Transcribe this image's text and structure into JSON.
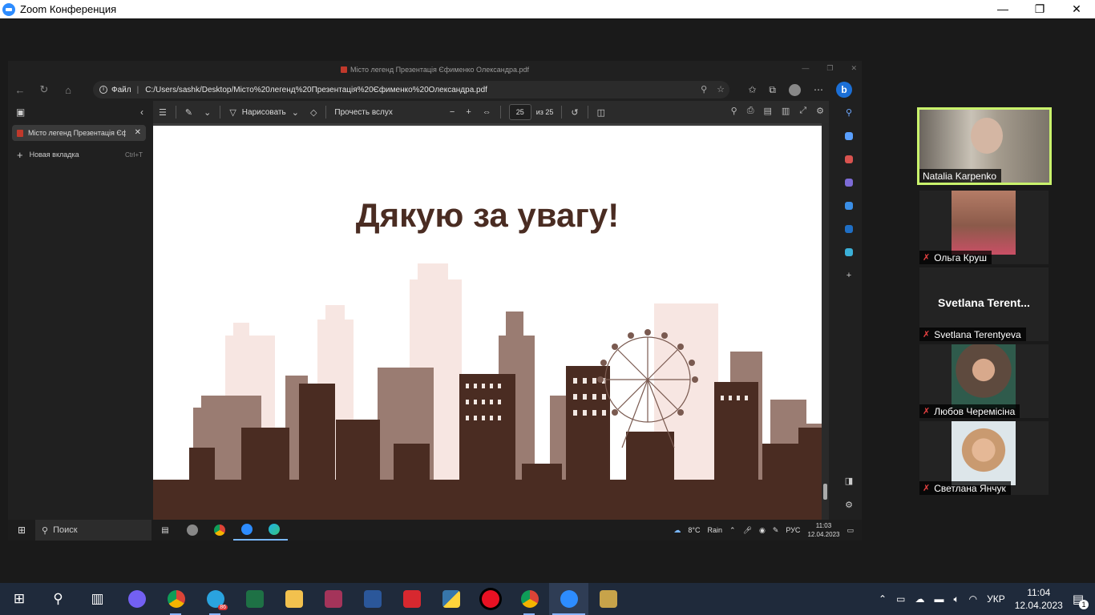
{
  "zoom_window": {
    "title": "Zoom Конференция",
    "minimize": "—",
    "restore": "❐",
    "close": "✕"
  },
  "edge": {
    "window_title": "Місто легенд Презентація Єфименко Олександра.pdf",
    "address": {
      "file_label": "Файл",
      "separator": "|",
      "url": "C:/Users/sashk/Desktop/Місто%20легенд%20Презентація%20Єфименко%20Олександра.pdf"
    },
    "tabs": [
      {
        "label": "Місто легенд Презентація Єфименко Олександра.pdf"
      }
    ],
    "new_tab": {
      "label": "Новая вкладка",
      "shortcut": "Ctrl+T"
    },
    "pdf_toolbar": {
      "draw_label": "Нарисовать",
      "read_aloud_label": "Прочесть вслух",
      "current_page": "25",
      "total_pages": "из 25"
    }
  },
  "slide": {
    "title": "Дякую за увагу!"
  },
  "inner_taskbar": {
    "search_label": "Поиск",
    "weather_temp": "8°C",
    "weather_text": "Rain",
    "language": "РУС",
    "time": "11:03",
    "date": "12.04.2023"
  },
  "participants": [
    {
      "name": "Natalia Karpenko",
      "active": true,
      "muted": false,
      "photo_color": "#a59c8e"
    },
    {
      "name": "Ольга Круш",
      "active": false,
      "muted": true,
      "photo_color": "#8b5a4a"
    },
    {
      "name": "Svetlana Terentyeva",
      "display_name": "Svetlana  Terent...",
      "active": false,
      "muted": true
    },
    {
      "name": "Любов Черемісіна",
      "active": false,
      "muted": true,
      "photo_color": "#5e4a3e"
    },
    {
      "name": "Светлана Янчук",
      "active": false,
      "muted": true,
      "photo_color": "#c99a70"
    }
  ],
  "taskbar": {
    "language": "УКР",
    "time": "11:04",
    "date": "12.04.2023",
    "telegram_badge": "86",
    "notifications_count": "1"
  }
}
